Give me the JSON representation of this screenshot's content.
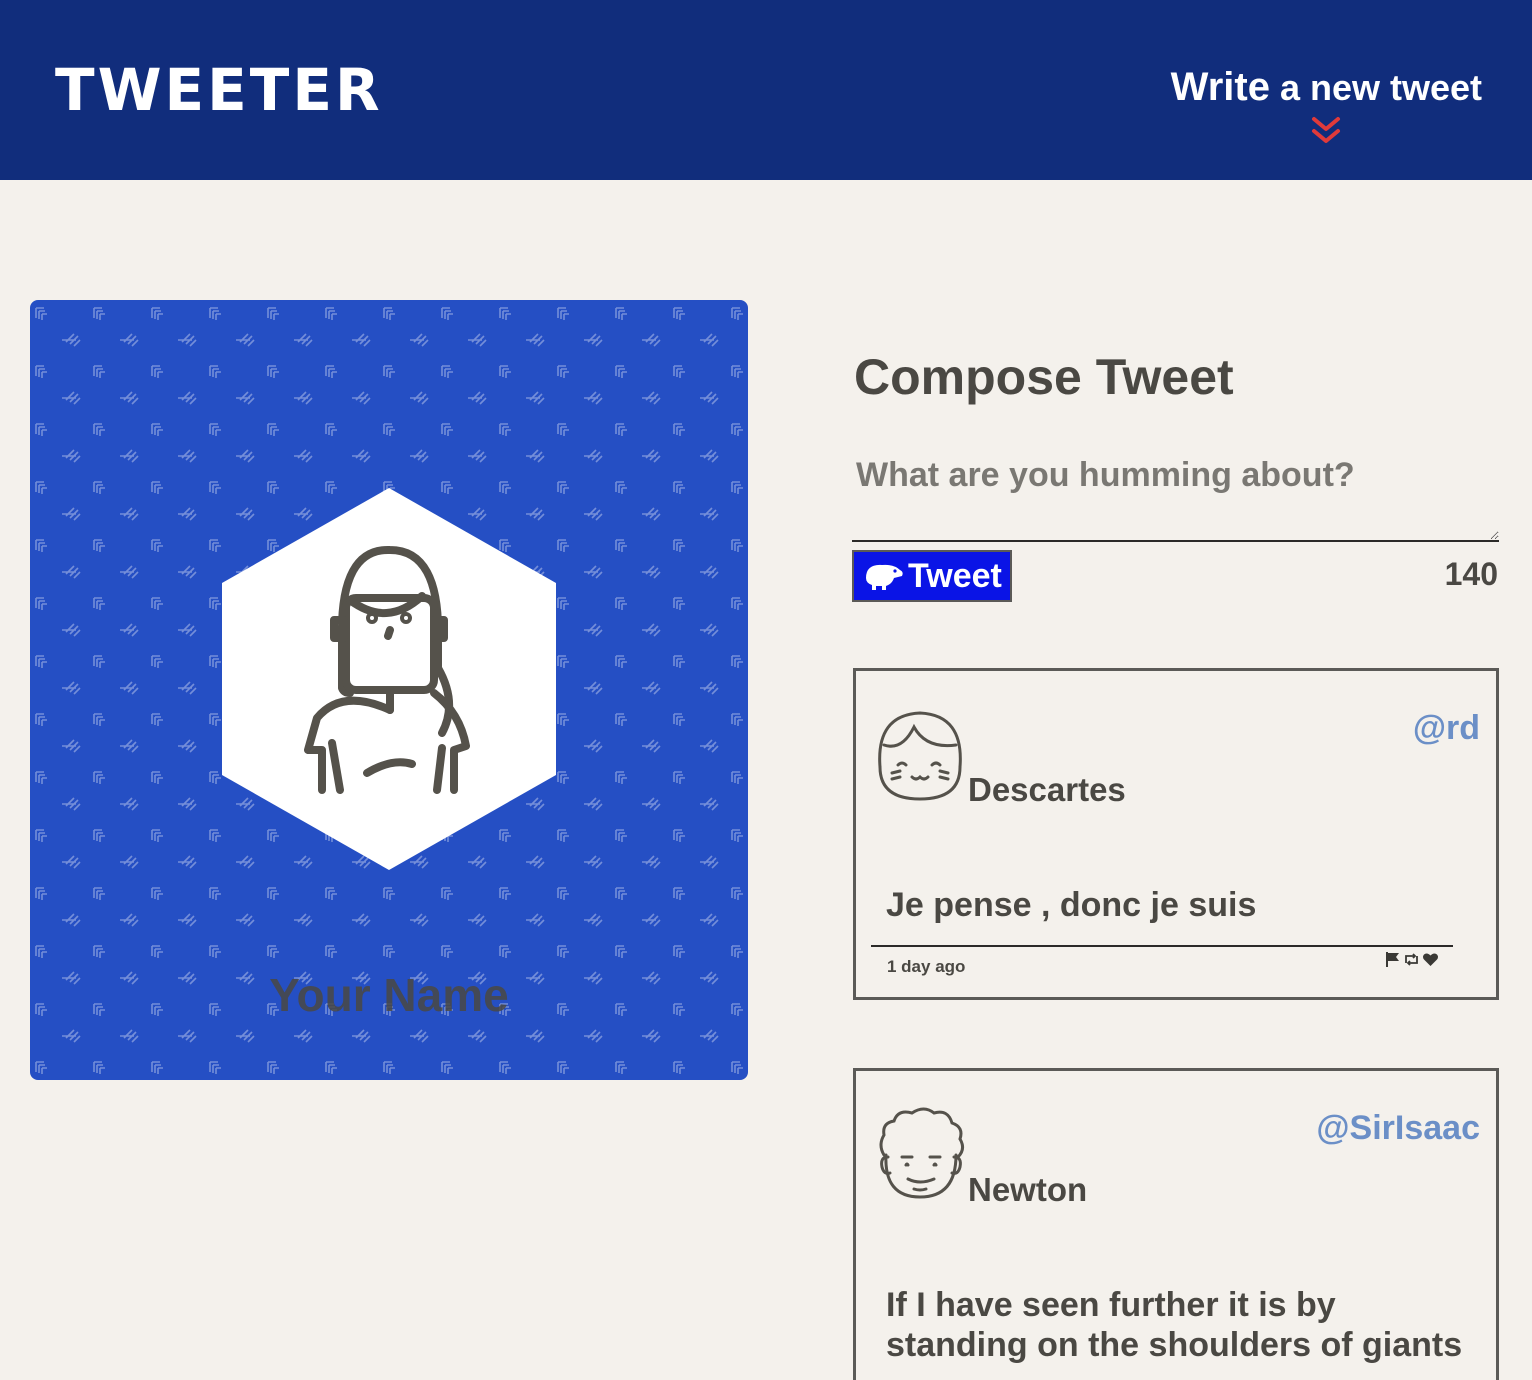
{
  "nav": {
    "brand": "TWEETER",
    "write_word": "Write",
    "write_rest": " a new tweet"
  },
  "profile": {
    "name": "Your Name"
  },
  "compose": {
    "title": "Compose Tweet",
    "placeholder": "What are you humming about?",
    "button_label": "Tweet",
    "counter": "140"
  },
  "tweets": [
    {
      "name": "Descartes",
      "handle": "@rd",
      "text": "Je pense , donc je suis",
      "timestamp": "1 day ago"
    },
    {
      "name": "Newton",
      "handle": "@SirIsaac",
      "text": "If I have seen further it is by standing on the shoulders of giants"
    }
  ],
  "colors": {
    "nav_bg": "#112d7c",
    "page_bg": "#f4f1ec",
    "profile_bg": "#254fc4",
    "button_bg": "#0a14e6",
    "handle": "#6b8fc7",
    "chevron": "#e03a3a"
  },
  "icons": {
    "chevron": "chevron-double-down-icon",
    "bird": "bird-icon",
    "flag": "flag-icon",
    "retweet": "retweet-icon",
    "heart": "heart-icon"
  }
}
